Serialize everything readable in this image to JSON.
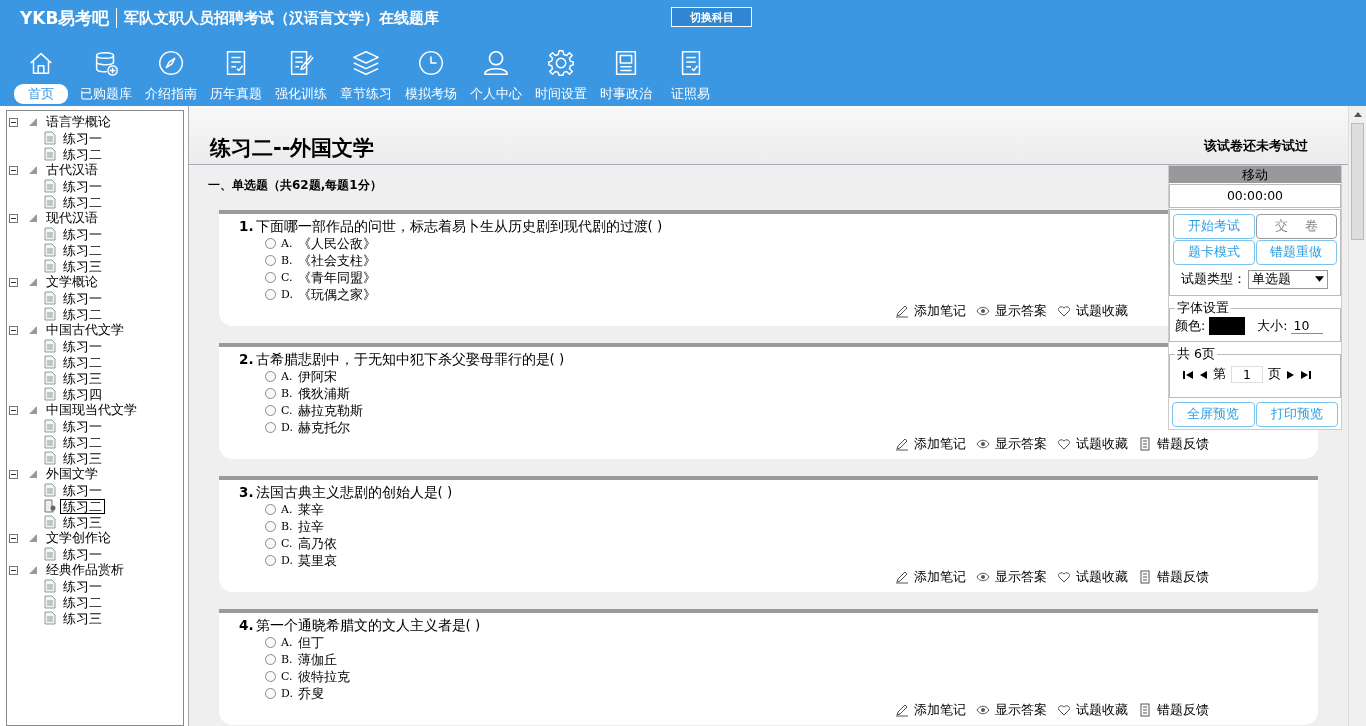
{
  "header": {
    "logo": "YKB易考吧",
    "title": "军队文职人员招聘考试（汉语言文学）在线题库",
    "switch_button": "切换科目"
  },
  "nav": [
    {
      "label": "首页",
      "selected": true
    },
    {
      "label": "已购题库",
      "selected": false
    },
    {
      "label": "介绍指南",
      "selected": false
    },
    {
      "label": "历年真题",
      "selected": false
    },
    {
      "label": "强化训练",
      "selected": false
    },
    {
      "label": "章节练习",
      "selected": false
    },
    {
      "label": "模拟考场",
      "selected": false
    },
    {
      "label": "个人中心",
      "selected": false
    },
    {
      "label": "时间设置",
      "selected": false
    },
    {
      "label": "时事政治",
      "selected": false
    },
    {
      "label": "证照易",
      "selected": false
    }
  ],
  "tree": [
    {
      "label": "语言学概论",
      "expanded": true,
      "children": [
        {
          "label": "练习一",
          "selected": false
        },
        {
          "label": "练习二",
          "selected": false
        }
      ]
    },
    {
      "label": "古代汉语",
      "expanded": true,
      "children": [
        {
          "label": "练习一",
          "selected": false
        },
        {
          "label": "练习二",
          "selected": false
        }
      ]
    },
    {
      "label": "现代汉语",
      "expanded": true,
      "children": [
        {
          "label": "练习一",
          "selected": false
        },
        {
          "label": "练习二",
          "selected": false
        },
        {
          "label": "练习三",
          "selected": false
        }
      ]
    },
    {
      "label": "文学概论",
      "expanded": true,
      "children": [
        {
          "label": "练习一",
          "selected": false
        },
        {
          "label": "练习二",
          "selected": false
        }
      ]
    },
    {
      "label": "中国古代文学",
      "expanded": true,
      "children": [
        {
          "label": "练习一",
          "selected": false
        },
        {
          "label": "练习二",
          "selected": false
        },
        {
          "label": "练习三",
          "selected": false
        },
        {
          "label": "练习四",
          "selected": false
        }
      ]
    },
    {
      "label": "中国现当代文学",
      "expanded": true,
      "children": [
        {
          "label": "练习一",
          "selected": false
        },
        {
          "label": "练习二",
          "selected": false
        },
        {
          "label": "练习三",
          "selected": false
        }
      ]
    },
    {
      "label": "外国文学",
      "expanded": true,
      "children": [
        {
          "label": "练习一",
          "selected": false
        },
        {
          "label": "练习二",
          "selected": true
        },
        {
          "label": "练习三",
          "selected": false
        }
      ]
    },
    {
      "label": "文学创作论",
      "expanded": true,
      "children": [
        {
          "label": "练习一",
          "selected": false
        }
      ]
    },
    {
      "label": "经典作品赏析",
      "expanded": true,
      "children": [
        {
          "label": "练习一",
          "selected": false
        },
        {
          "label": "练习二",
          "selected": false
        },
        {
          "label": "练习三",
          "selected": false
        }
      ]
    }
  ],
  "paper": {
    "title": "练习二--外国文学",
    "status": "该试卷还未考试过",
    "section": "一、单选题（共62题,每题1分）"
  },
  "questions": [
    {
      "number": "1.",
      "text": "下面哪一部作品的问世，标志着易卜生从历史剧到现代剧的过渡( )",
      "options": [
        {
          "letter": "A.",
          "text": "《人民公敌》",
          "selected": false
        },
        {
          "letter": "B.",
          "text": "《社会支柱》",
          "selected": false
        },
        {
          "letter": "C.",
          "text": "《青年同盟》",
          "selected": false
        },
        {
          "letter": "D.",
          "text": "《玩偶之家》",
          "selected": false
        }
      ]
    },
    {
      "number": "2.",
      "text": "古希腊悲剧中，于无知中犯下杀父娶母罪行的是( )",
      "options": [
        {
          "letter": "A.",
          "text": "伊阿宋",
          "selected": false
        },
        {
          "letter": "B.",
          "text": "俄狄浦斯",
          "selected": false
        },
        {
          "letter": "C.",
          "text": "赫拉克勒斯",
          "selected": false
        },
        {
          "letter": "D.",
          "text": "赫克托尔",
          "selected": false
        }
      ]
    },
    {
      "number": "3.",
      "text": "法国古典主义悲剧的创始人是( )",
      "options": [
        {
          "letter": "A.",
          "text": "莱辛",
          "selected": false
        },
        {
          "letter": "B.",
          "text": "拉辛",
          "selected": false
        },
        {
          "letter": "C.",
          "text": "高乃依",
          "selected": false
        },
        {
          "letter": "D.",
          "text": "莫里哀",
          "selected": false
        }
      ]
    },
    {
      "number": "4.",
      "text": "第一个通晓希腊文的文人主义者是( )",
      "options": [
        {
          "letter": "A.",
          "text": "但丁",
          "selected": false
        },
        {
          "letter": "B.",
          "text": "薄伽丘",
          "selected": false
        },
        {
          "letter": "C.",
          "text": "彼特拉克",
          "selected": false
        },
        {
          "letter": "D.",
          "text": "乔叟",
          "selected": false
        }
      ]
    }
  ],
  "question_actions": [
    [
      {
        "kind": "note",
        "label": "添加笔记"
      },
      {
        "kind": "answer",
        "label": "显示答案"
      },
      {
        "kind": "favorite",
        "label": "试题收藏"
      }
    ],
    [
      {
        "kind": "note",
        "label": "添加笔记"
      },
      {
        "kind": "answer",
        "label": "显示答案"
      },
      {
        "kind": "favorite",
        "label": "试题收藏"
      },
      {
        "kind": "feedback",
        "label": "错题反馈"
      }
    ],
    [
      {
        "kind": "note",
        "label": "添加笔记"
      },
      {
        "kind": "answer",
        "label": "显示答案"
      },
      {
        "kind": "favorite",
        "label": "试题收藏"
      },
      {
        "kind": "feedback",
        "label": "错题反馈"
      }
    ],
    [
      {
        "kind": "note",
        "label": "添加笔记"
      },
      {
        "kind": "answer",
        "label": "显示答案"
      },
      {
        "kind": "favorite",
        "label": "试题收藏"
      },
      {
        "kind": "feedback",
        "label": "错题反馈"
      }
    ]
  ],
  "panel": {
    "title": "移动",
    "timer": "00:00:00",
    "buttons": [
      {
        "label": "开始考试",
        "disabled": false
      },
      {
        "label": "交　 卷",
        "disabled": true
      },
      {
        "label": "题卡模式",
        "disabled": false
      },
      {
        "label": "错题重做",
        "disabled": false
      }
    ],
    "type_label": "试题类型：",
    "type_value": "单选题",
    "font_legend": "字体设置",
    "color_label": "颜色:",
    "size_label": "大小:",
    "size_value": "10",
    "pages_legend": "共 6页",
    "page_prefix": "第",
    "page_value": "1",
    "page_suffix": "页",
    "bottom_buttons": [
      "全屏预览",
      "打印预览"
    ]
  }
}
